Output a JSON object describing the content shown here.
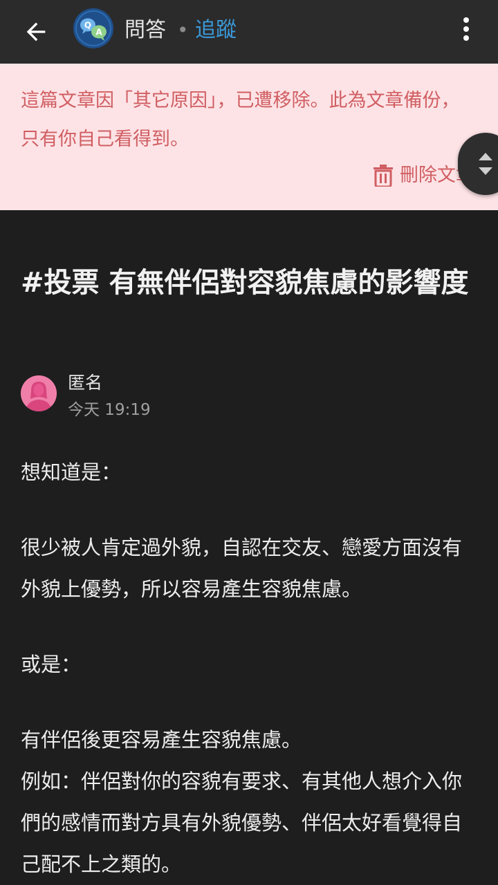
{
  "header": {
    "board_name": "問答",
    "separator": "•",
    "follow_label": "追蹤",
    "board_avatar_letters": [
      "Q",
      "A"
    ]
  },
  "notice": {
    "text": "這篇文章因「其它原因」，已遭移除。此為文章備份，只有你自己看得到。",
    "delete_label": "刪除文章",
    "text_color": "#d05e62",
    "background_color": "#fde3e6"
  },
  "post": {
    "title": "#投票 有無伴侶對容貌焦慮的影響度",
    "author": "匿名",
    "time": "今天 19:19",
    "paragraphs": [
      "想知道是：",
      "很少被人肯定過外貌，自認在交友、戀愛方面沒有外貌上優勢，所以容易產生容貌焦慮。",
      "或是：",
      "有伴侶後更容易產生容貌焦慮。",
      "例如：伴侶對你的容貌有要求、有其他人想介入你們的感情而對方具有外貌優勢、伴侶太好看覺得自己配不上之類的。"
    ]
  },
  "icons": {
    "back": "arrow-left-icon",
    "more": "more-vertical-icon",
    "delete": "trash-icon",
    "scroll": "scroll-up-down-icon"
  },
  "colors": {
    "accent": "#3b9ad9",
    "background": "#1e1e1f",
    "header": "#2b2b2c",
    "avatar": "#ef7fa9"
  }
}
